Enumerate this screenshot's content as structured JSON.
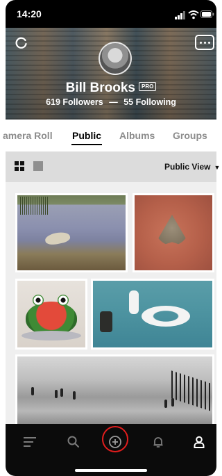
{
  "status": {
    "time": "14:20"
  },
  "profile": {
    "name": "Bill Brooks",
    "badge": "PRO",
    "followers": "619 Followers",
    "separator": "—",
    "following": "55 Following"
  },
  "tabs": [
    {
      "label": "amera Roll",
      "active": false
    },
    {
      "label": "Public",
      "active": true
    },
    {
      "label": "Albums",
      "active": false
    },
    {
      "label": "Groups",
      "active": false
    }
  ],
  "filter": {
    "view_label": "Public View",
    "caret": "▼"
  },
  "photos": [
    "photo-heron-wetland",
    "photo-moth-on-brick",
    "photo-watermelon-frog",
    "photo-unicorn-float-sea",
    "photo-beach-bw"
  ],
  "tabbar": {
    "icons": [
      "menu-icon",
      "search-icon",
      "add-icon",
      "bell-icon",
      "profile-icon"
    ],
    "active": "profile-icon",
    "highlight_color": "#e21d1d"
  }
}
